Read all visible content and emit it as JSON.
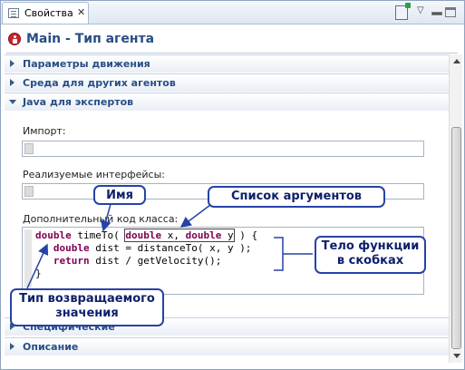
{
  "tab": {
    "label": "Свойства",
    "close": "✕"
  },
  "header": {
    "title": "Main - Тип агента"
  },
  "sections": [
    {
      "label": "Параметры движения",
      "expanded": false
    },
    {
      "label": "Среда для других агентов",
      "expanded": false
    },
    {
      "label": "Java для экспертов",
      "expanded": true
    },
    {
      "label": "Специфические",
      "expanded": false
    },
    {
      "label": "Описание",
      "expanded": false
    }
  ],
  "fields": {
    "import_label": "Импорт:",
    "interfaces_label": "Реализуемые интерфейсы:",
    "code_label": "Дополнительный код класса:"
  },
  "code_lines": [
    "double timeTo( double x, double y ) {",
    "   double dist = distanceTo( x, y );",
    "   return dist / getVelocity();",
    "}"
  ],
  "callouts": {
    "name": "Имя",
    "args": "Список аргументов",
    "body_line1": "Тело функции",
    "body_line2": "в скобках",
    "ret_line1": "Тип возвращаемого",
    "ret_line2": "значения"
  },
  "colors": {
    "accent": "#284e85",
    "callout_border": "#2742a6",
    "keyword": "#7f0055"
  }
}
